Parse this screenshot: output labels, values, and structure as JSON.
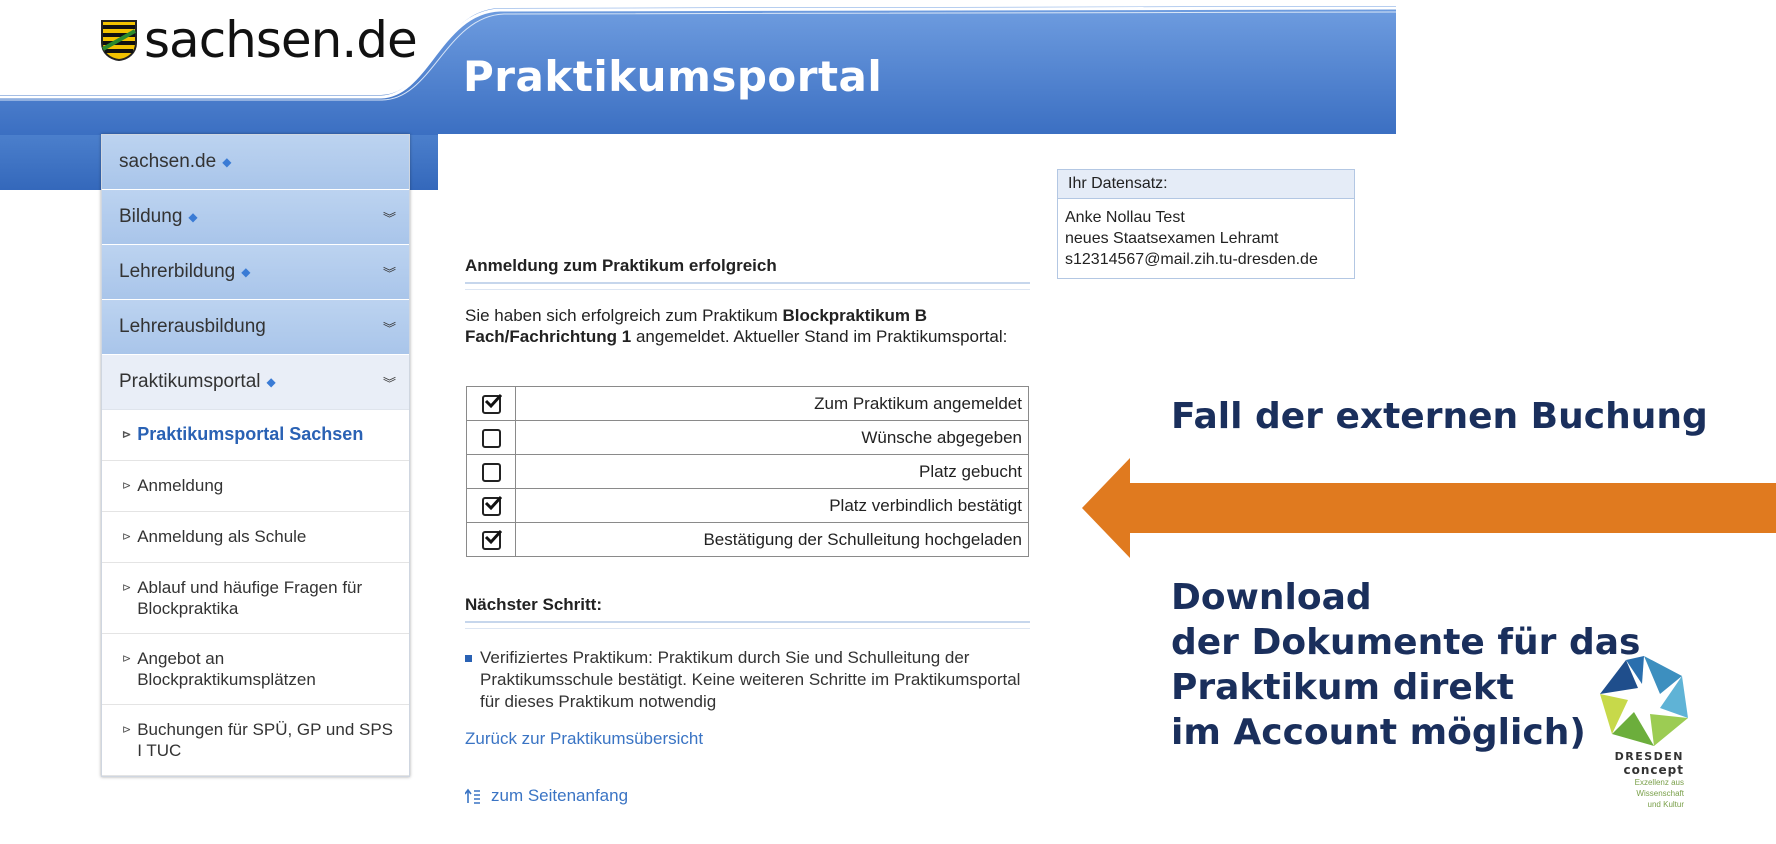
{
  "header": {
    "logo_text": "sachsen.de",
    "portal_title": "Praktikumsportal"
  },
  "sidebar": {
    "top_items": [
      {
        "label": "sachsen.de",
        "dot": "◆"
      },
      {
        "label": "Bildung",
        "dot": "◆",
        "chevron": "︾"
      },
      {
        "label": "Lehrerbildung",
        "dot": "◆",
        "chevron": "︾"
      },
      {
        "label": "Lehrerausbildung",
        "chevron": "︾"
      },
      {
        "label": "Praktikumsportal",
        "dot": "◆",
        "chevron": "︾"
      }
    ],
    "sub_items": [
      {
        "label": "Praktikumsportal Sachsen"
      },
      {
        "label": "Anmeldung"
      },
      {
        "label": "Anmeldung als Schule"
      },
      {
        "label": "Ablauf und häufige Fragen für Blockpraktika"
      },
      {
        "label": "Angebot an Blockpraktikumsplätzen"
      },
      {
        "label": "Buchungen für SPÜ, GP und SPS I TUC"
      }
    ],
    "sub_marker": "⊳"
  },
  "main": {
    "success_title": "Anmeldung zum Praktikum erfolgreich",
    "intro_prefix": "Sie haben sich erfolgreich zum Praktikum ",
    "intro_bold": "Blockpraktikum B Fach/Fachrichtung 1",
    "intro_suffix": " angemeldet. Aktueller Stand im Praktikumsportal:",
    "steps": [
      {
        "label": "Zum Praktikum angemeldet",
        "checked": true
      },
      {
        "label": "Wünsche abgegeben",
        "checked": false
      },
      {
        "label": "Platz gebucht",
        "checked": false
      },
      {
        "label": "Platz verbindlich bestätigt",
        "checked": true
      },
      {
        "label": "Bestätigung der Schulleitung hochgeladen",
        "checked": true
      }
    ],
    "next_title": "Nächster Schritt:",
    "next_text": "Verifiziertes Praktikum: Praktikum durch Sie und Schulleitung der Praktikumsschule bestätigt. Keine weiteren Schritte im Praktikumsportal für dieses Praktikum notwendig",
    "back_link": "Zurück zur Praktikumsübersicht",
    "top_link": "zum Seitenanfang"
  },
  "databox": {
    "title": "Ihr Datensatz:",
    "name": "Anke Nollau Test",
    "program": "neues Staatsexamen Lehramt",
    "email": "s12314567@mail.zih.tu-dresden.de"
  },
  "annotation": {
    "heading": "Fall der externen Buchung",
    "line1": "Download",
    "line2": "der Dokumente für das",
    "line3": "Praktikum direkt",
    "line4": "im Account möglich)",
    "arrow_color": "#e07a1f"
  },
  "dresden_concept": {
    "name": "DRESDEN",
    "concept": "concept",
    "line1": "Exzellenz aus",
    "line2": "Wissenschaft",
    "line3": "und Kultur"
  },
  "colors": {
    "header_blue": "#3f78c8",
    "link_blue": "#3a74c4",
    "annotation_navy": "#1a2f5c"
  }
}
